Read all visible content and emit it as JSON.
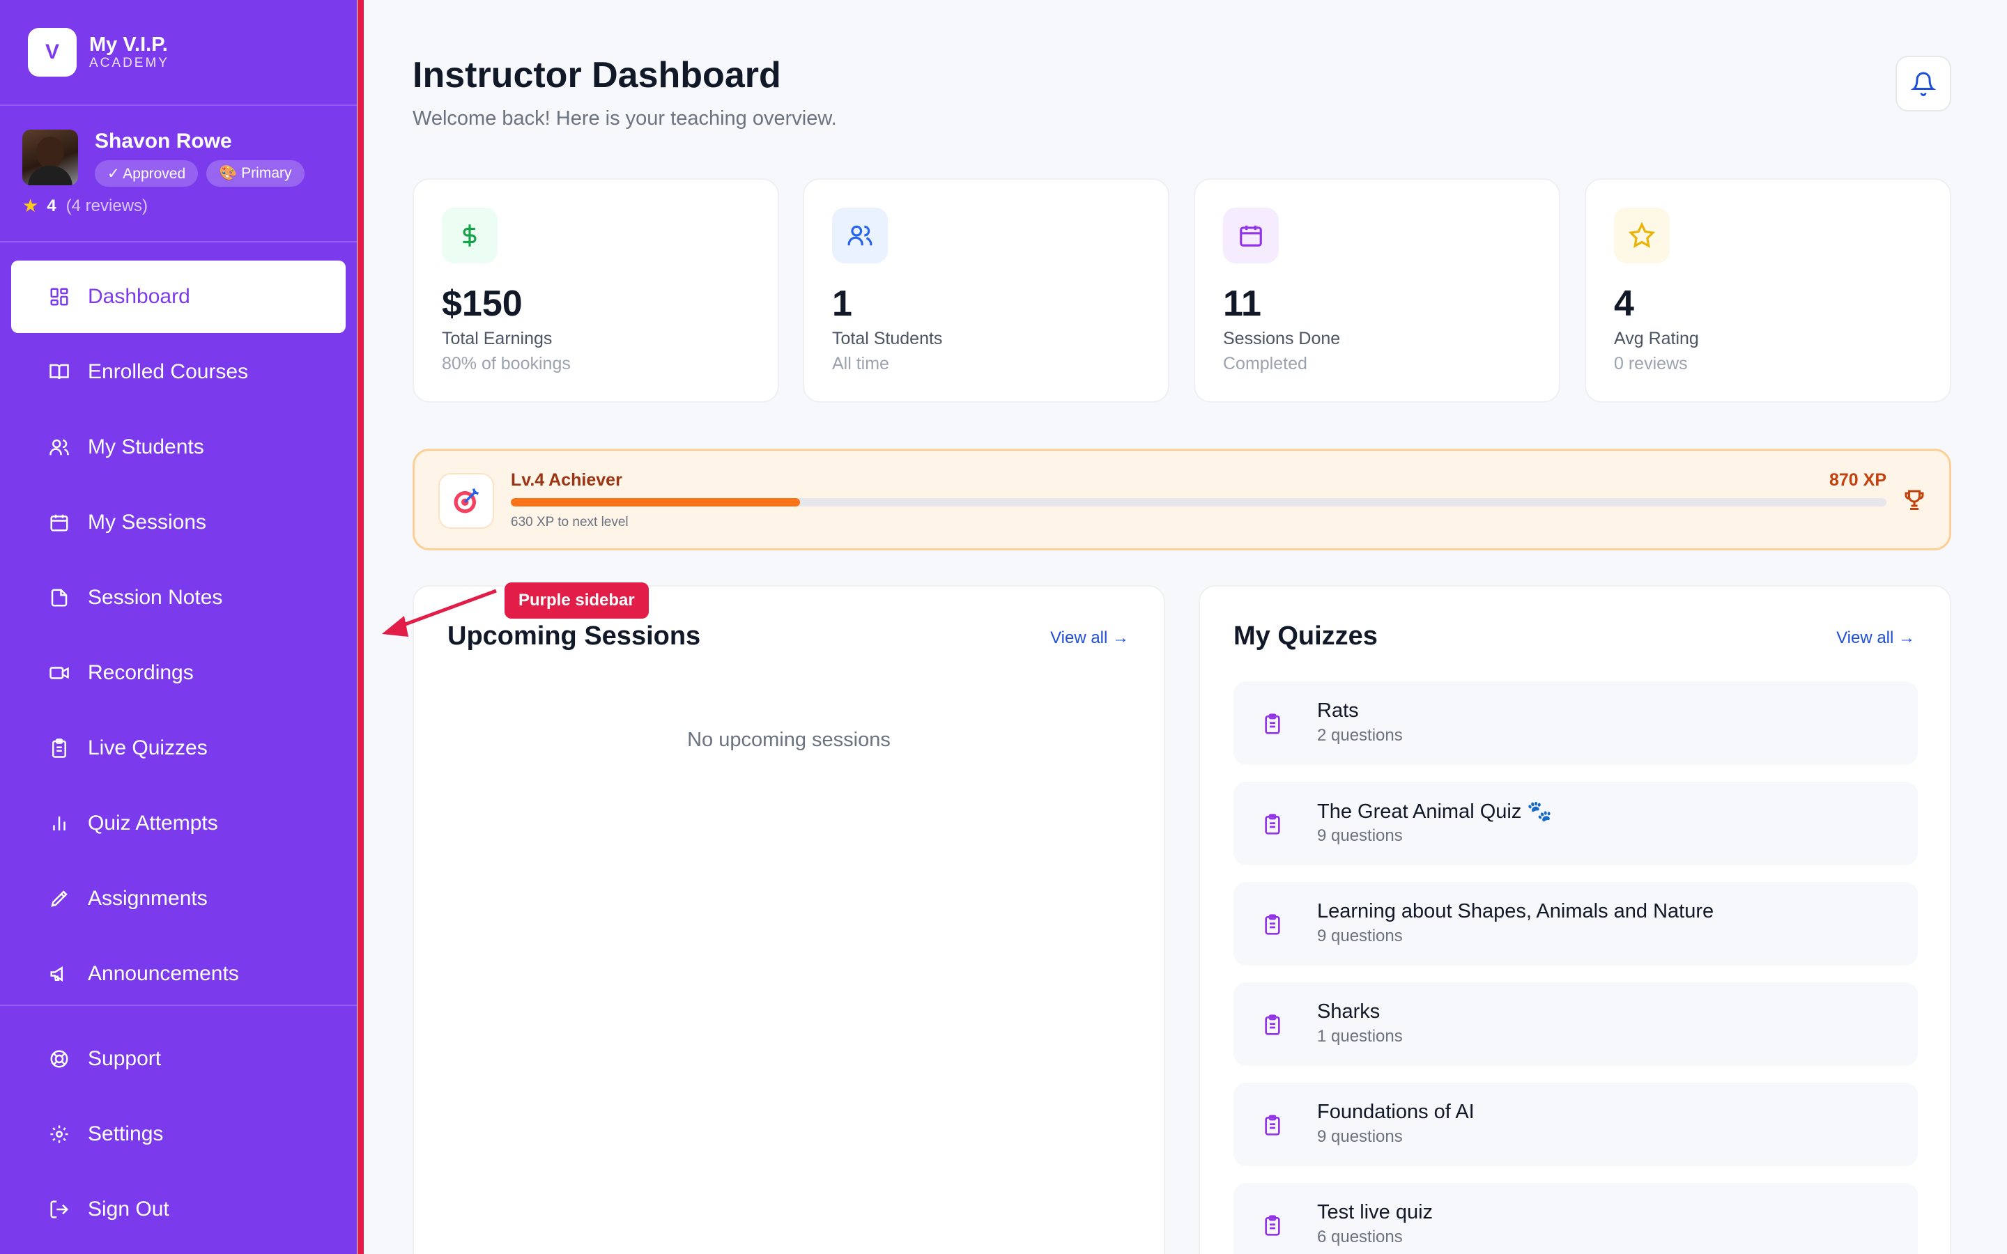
{
  "brand": {
    "logo_letter": "V",
    "name": "My V.I.P.",
    "subtitle": "ACADEMY"
  },
  "profile": {
    "name": "Shavon Rowe",
    "badge_approved": "✓ Approved",
    "badge_primary": "🎨 Primary",
    "rating": "4",
    "reviews": "(4 reviews)"
  },
  "nav": {
    "items": [
      {
        "label": "Dashboard",
        "icon": "dashboard-icon",
        "active": true
      },
      {
        "label": "Enrolled Courses",
        "icon": "book-icon"
      },
      {
        "label": "My Students",
        "icon": "users-icon"
      },
      {
        "label": "My Sessions",
        "icon": "calendar-icon"
      },
      {
        "label": "Session Notes",
        "icon": "note-icon"
      },
      {
        "label": "Recordings",
        "icon": "video-icon"
      },
      {
        "label": "Live Quizzes",
        "icon": "clipboard-icon"
      },
      {
        "label": "Quiz Attempts",
        "icon": "bar-chart-icon"
      },
      {
        "label": "Assignments",
        "icon": "pen-icon"
      },
      {
        "label": "Announcements",
        "icon": "megaphone-icon"
      }
    ],
    "bottom": [
      {
        "label": "Support",
        "icon": "lifebuoy-icon"
      },
      {
        "label": "Settings",
        "icon": "gear-icon"
      },
      {
        "label": "Sign Out",
        "icon": "sign-out-icon"
      }
    ]
  },
  "header": {
    "title": "Instructor Dashboard",
    "subtitle": "Welcome back! Here is your teaching overview."
  },
  "stats": [
    {
      "value": "$150",
      "label": "Total Earnings",
      "sub": "80% of bookings",
      "icon": "dollar-icon",
      "color": "#16a34a",
      "bg": "#ecfdf3"
    },
    {
      "value": "1",
      "label": "Total Students",
      "sub": "All time",
      "icon": "users-icon",
      "color": "#2563eb",
      "bg": "#eaf2fe"
    },
    {
      "value": "11",
      "label": "Sessions Done",
      "sub": "Completed",
      "icon": "calendar-icon",
      "color": "#9333ea",
      "bg": "#f5edfe"
    },
    {
      "value": "4",
      "label": "Avg Rating",
      "sub": "0 reviews",
      "icon": "star-icon",
      "color": "#eab308",
      "bg": "#fef8e6"
    }
  ],
  "level": {
    "name": "Lv.4 Achiever",
    "xp": "870 XP",
    "next": "630 XP to next level",
    "progress_fraction": 0.21
  },
  "sessions": {
    "title": "Upcoming Sessions",
    "view_all": "View all →",
    "empty": "No upcoming sessions"
  },
  "quizzes": {
    "title": "My Quizzes",
    "view_all": "View all →",
    "items": [
      {
        "title": "Rats",
        "count": "2 questions"
      },
      {
        "title": "The Great Animal Quiz 🐾",
        "count": "9 questions"
      },
      {
        "title": "Learning about Shapes, Animals and Nature",
        "count": "9 questions"
      },
      {
        "title": "Sharks",
        "count": "1 questions"
      },
      {
        "title": "Foundations of AI",
        "count": "9 questions"
      },
      {
        "title": "Test live quiz",
        "count": "6 questions"
      }
    ]
  },
  "annotation": {
    "label": "Purple sidebar"
  },
  "colors": {
    "sidebar": "#7c3aed",
    "accent_red": "#e11d48",
    "xp_orange": "#f97316"
  }
}
